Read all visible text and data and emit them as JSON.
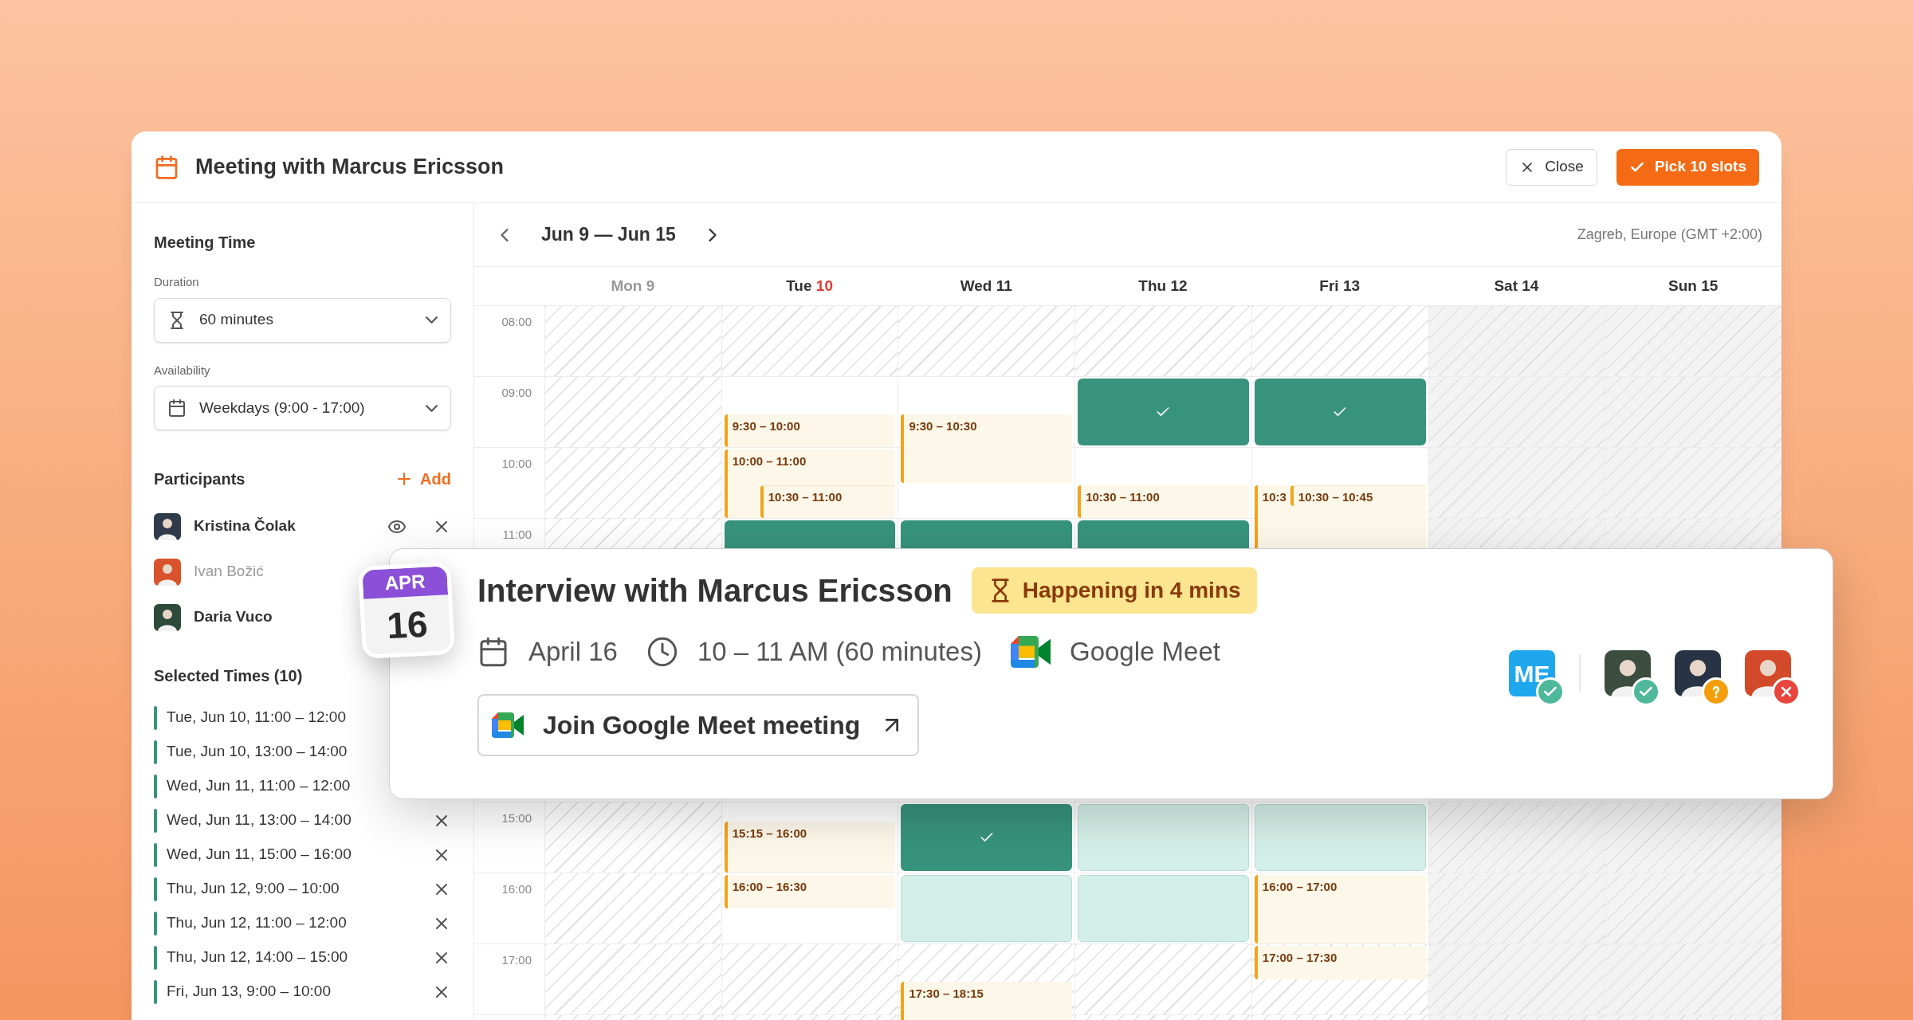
{
  "header": {
    "title": "Meeting with Marcus Ericsson",
    "buttons": [
      {
        "label": "Close",
        "kind": "close"
      },
      {
        "label": "Pick 10 slots",
        "kind": "primary"
      }
    ]
  },
  "sidebar": {
    "meeting_time": {
      "title": "Meeting Time",
      "fields": [
        {
          "label": "Duration",
          "value": "60 minutes",
          "kind": "duration"
        },
        {
          "label": "Availability",
          "value": "Weekdays (9:00 - 17:00)",
          "kind": "calendar"
        }
      ]
    },
    "participants": {
      "title": "Participants",
      "add_label": "Add",
      "items": [
        {
          "name": "Kristina Čolak",
          "muted": false,
          "color": "#2f3b4a",
          "actions": true
        },
        {
          "name": "Ivan Božić",
          "muted": true,
          "color": "#d9532c"
        },
        {
          "name": "Daria Vuco",
          "muted": false,
          "color": "#2e4a3a"
        }
      ]
    },
    "selected_times": {
      "title": "Selected Times (10)",
      "items": [
        "Tue, Jun 10, 11:00 – 12:00",
        "Tue, Jun 10, 13:00 – 14:00",
        "Wed, Jun 11, 11:00 – 12:00",
        "Wed, Jun 11, 13:00 – 14:00",
        "Wed, Jun 11, 15:00 – 16:00",
        "Thu, Jun 12, 9:00 – 10:00",
        "Thu, Jun 12, 11:00 – 12:00",
        "Thu, Jun 12, 14:00 – 15:00",
        "Fri, Jun 13, 9:00 – 10:00"
      ]
    }
  },
  "calendar": {
    "range": "Jun 9 — Jun 15",
    "timezone": "Zagreb, Europe (GMT +2:00)",
    "days": [
      {
        "name": "Mon",
        "date": "9",
        "kind": "past",
        "today": false
      },
      {
        "name": "Tue",
        "date": "10",
        "kind": "open",
        "today": true,
        "events": [
          {
            "text": "9:30 – 10:00"
          },
          {
            "text": "10:00 – 11:00",
            "overlaps": [
              {
                "text": "10:30 – 11:00"
              }
            ]
          },
          {
            "text": "15:15 – 16:00"
          },
          {
            "text": "16:00 – 16:30"
          }
        ]
      },
      {
        "name": "Wed",
        "date": "11",
        "kind": "open",
        "today": false,
        "events": [
          {
            "text": "9:30 – 10:30"
          },
          {
            "text": "17:30 – 18:15"
          }
        ]
      },
      {
        "name": "Thu",
        "date": "12",
        "kind": "open",
        "today": false,
        "events": [
          {
            "text": "10:30 – 11:00"
          }
        ]
      },
      {
        "name": "Fri",
        "date": "13",
        "kind": "open",
        "today": false,
        "events": [
          {
            "text": "10:3",
            "overlaps": [
              {
                "text": "10:30 – 10:45"
              }
            ]
          },
          {
            "text": "16:00 – 17:00"
          },
          {
            "text": "17:00 – 17:30"
          }
        ]
      },
      {
        "name": "Sat",
        "date": "14",
        "kind": "weekend",
        "today": false
      },
      {
        "name": "Sun",
        "date": "15",
        "kind": "weekend",
        "today": false
      }
    ],
    "rows_above": [
      {
        "label": "08:00",
        "cells": [
          {
            "kind": "blocked"
          },
          {
            "kind": "blocked"
          },
          {
            "kind": "blocked"
          },
          {
            "kind": "blocked"
          },
          {
            "kind": "blocked"
          },
          {
            "kind": "blocked"
          },
          {
            "kind": "blocked"
          }
        ]
      },
      {
        "label": "09:00",
        "cells": [
          {
            "kind": "blocked"
          },
          {
            "kind": "open"
          },
          {
            "kind": "open"
          },
          {
            "kind": "selected",
            "ticked": true
          },
          {
            "kind": "selected",
            "ticked": true
          },
          {
            "kind": "blocked"
          },
          {
            "kind": "blocked"
          }
        ]
      },
      {
        "label": "10:00",
        "cells": [
          {
            "kind": "blocked"
          },
          {
            "kind": "open"
          },
          {
            "kind": "open"
          },
          {
            "kind": "open"
          },
          {
            "kind": "open"
          },
          {
            "kind": "blocked"
          },
          {
            "kind": "blocked"
          }
        ]
      },
      {
        "label": "11:00",
        "cells": [
          {
            "kind": "blocked"
          },
          {
            "kind": "selected"
          },
          {
            "kind": "selected"
          },
          {
            "kind": "selected"
          },
          {
            "kind": "open"
          },
          {
            "kind": "blocked"
          },
          {
            "kind": "blocked"
          }
        ]
      }
    ],
    "rows_below": [
      {
        "label": "15:00",
        "cells": [
          {
            "kind": "blocked"
          },
          {
            "kind": "open"
          },
          {
            "kind": "selected",
            "ticked": true
          },
          {
            "kind": "available"
          },
          {
            "kind": "available"
          },
          {
            "kind": "blocked"
          },
          {
            "kind": "blocked"
          }
        ]
      },
      {
        "label": "16:00",
        "cells": [
          {
            "kind": "blocked"
          },
          {
            "kind": "open"
          },
          {
            "kind": "available"
          },
          {
            "kind": "available"
          },
          {
            "kind": "open"
          },
          {
            "kind": "blocked"
          },
          {
            "kind": "blocked"
          }
        ]
      },
      {
        "label": "17:00",
        "cells": [
          {
            "kind": "blocked"
          },
          {
            "kind": "blocked"
          },
          {
            "kind": "blocked"
          },
          {
            "kind": "blocked"
          },
          {
            "kind": "blocked"
          },
          {
            "kind": "blocked"
          },
          {
            "kind": "blocked"
          }
        ]
      }
    ]
  },
  "popup": {
    "date_badge": {
      "month": "APR",
      "day": "16"
    },
    "title": "Interview with Marcus Ericsson",
    "status": "Happening in 4 mins",
    "details": [
      {
        "kind": "date",
        "text": "April 16"
      },
      {
        "kind": "time",
        "text": "10 – 11 AM (60 minutes)"
      },
      {
        "kind": "video",
        "text": "Google Meet"
      }
    ],
    "join_label": "Join Google Meet meeting",
    "attendees": [
      {
        "initials": "ME",
        "kind": "accepted",
        "color": "#1ea7ef"
      },
      {
        "kind": "accepted",
        "color": "#3b4d3f"
      },
      {
        "kind": "maybe",
        "color": "#283445"
      },
      {
        "kind": "declined",
        "color": "#d24a2a"
      }
    ]
  }
}
